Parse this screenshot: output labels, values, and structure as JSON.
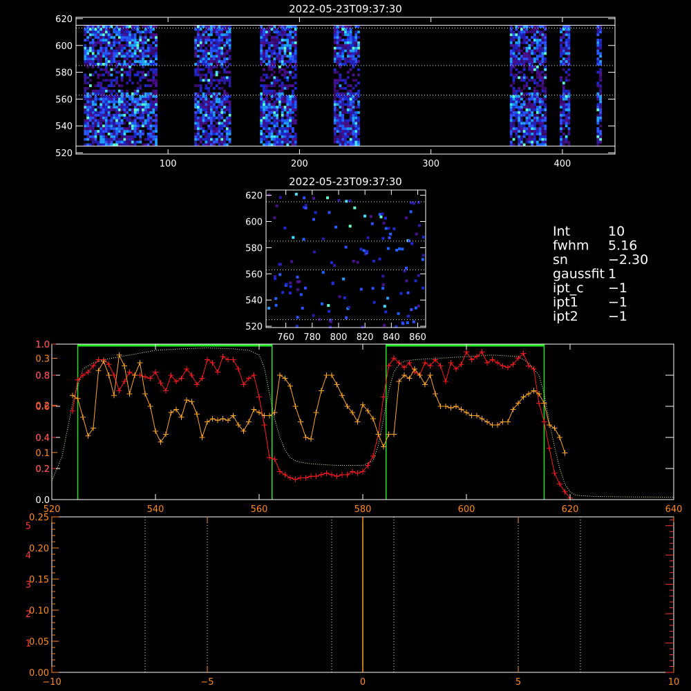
{
  "colors": {
    "background": "#000000",
    "axis": "#ffffff",
    "orange": "#ffa726",
    "red": "#ff1a1a",
    "green": "#22e622",
    "dotted_green": "#e8ffb0",
    "vertical_dotted": "#fff59d",
    "accent_orange_axis": "#ff8a1a",
    "accent_red_axis": "#ff3a3a"
  },
  "info_panel": {
    "lines": [
      {
        "key": "Int",
        "value": "10"
      },
      {
        "key": "fwhm",
        "value": "5.16"
      },
      {
        "key": "sn",
        "value": "−2.30"
      },
      {
        "key": "gaussfit",
        "value": "1"
      },
      {
        "key": "ipt_c",
        "value": "−1"
      },
      {
        "key": "ipt1",
        "value": "−1"
      },
      {
        "key": "ipt2",
        "value": "−1"
      }
    ]
  },
  "chart_data": [
    {
      "type": "heatmap",
      "title": "2022-05-23T09:37:30",
      "xlim": [
        30,
        440
      ],
      "ylim": [
        519,
        621
      ],
      "xticks": [
        100,
        200,
        300,
        400
      ],
      "yticks": [
        520,
        540,
        560,
        580,
        600,
        620
      ],
      "bright_column_bands": [
        [
          35,
          90
        ],
        [
          120,
          147
        ],
        [
          170,
          196
        ],
        [
          225,
          245
        ],
        [
          360,
          386
        ],
        [
          397,
          405
        ],
        [
          426,
          429
        ]
      ],
      "horizontal_lines": [
        {
          "y": 525,
          "style": "solid"
        },
        {
          "y": 615,
          "style": "solid"
        },
        {
          "y": 563,
          "style": "dotted"
        },
        {
          "y": 585,
          "style": "dotted"
        },
        {
          "y": 613,
          "style": "dotted"
        }
      ]
    },
    {
      "type": "heatmap",
      "title": "2022-05-23T09:37:30",
      "xlim": [
        745,
        866
      ],
      "ylim": [
        519,
        624
      ],
      "xticks": [
        760,
        780,
        800,
        820,
        840,
        860
      ],
      "yticks": [
        520,
        540,
        560,
        580,
        600,
        620
      ],
      "horizontal_lines": [
        {
          "y": 525,
          "style": "dotted"
        },
        {
          "y": 563,
          "style": "dotted"
        },
        {
          "y": 585,
          "style": "dotted"
        },
        {
          "y": 615,
          "style": "dotted"
        }
      ]
    },
    {
      "type": "line",
      "xlim": [
        520,
        640
      ],
      "xticks": [
        520,
        540,
        560,
        580,
        600,
        620,
        640
      ],
      "ylim": [
        0,
        1.0
      ],
      "left_axis_white_ticks": [
        "0.0",
        "0.2",
        "0.4",
        "0.6",
        "0.8",
        "1.0"
      ],
      "left_axis_white_tick_values": [
        0,
        0.2,
        0.4,
        0.6,
        0.8,
        1.0
      ],
      "left_axis_orange_ticks": [
        "0.1",
        "0.2",
        "0.3"
      ],
      "left_axis_orange_tick_values": [
        0.1,
        0.2,
        0.3
      ],
      "left_axis_orange_range": [
        0,
        0.33
      ],
      "left_axis_red_ticks": [
        "0.2",
        "0.4",
        "0.6",
        "0.8",
        "1.0"
      ],
      "left_axis_red_tick_values": [
        0.2,
        0.4,
        0.6,
        0.8,
        1.0
      ],
      "left_axis_red_range": [
        0,
        1.0
      ],
      "green_windows": [
        [
          525,
          562.5
        ],
        [
          584.5,
          615
        ]
      ],
      "series": [
        {
          "color": "#e8ffb0",
          "style": "dotted",
          "x": [
            520,
            522,
            524,
            526,
            528,
            530,
            535,
            540,
            545,
            550,
            555,
            558,
            560,
            561,
            562,
            563,
            564,
            565,
            566,
            567,
            568,
            570,
            575,
            580,
            582,
            583,
            584,
            585,
            586,
            587,
            588,
            590,
            595,
            600,
            605,
            610,
            612,
            614,
            615,
            616,
            617,
            618,
            619,
            620,
            621,
            622,
            625,
            630,
            635,
            640
          ],
          "y": [
            0.12,
            0.28,
            0.62,
            0.84,
            0.88,
            0.9,
            0.93,
            0.96,
            0.97,
            0.975,
            0.97,
            0.96,
            0.93,
            0.85,
            0.68,
            0.52,
            0.4,
            0.32,
            0.27,
            0.25,
            0.24,
            0.23,
            0.22,
            0.22,
            0.25,
            0.35,
            0.52,
            0.7,
            0.82,
            0.87,
            0.89,
            0.9,
            0.91,
            0.92,
            0.93,
            0.92,
            0.88,
            0.8,
            0.68,
            0.5,
            0.34,
            0.2,
            0.1,
            0.05,
            0.03,
            0.025,
            0.02,
            0.018,
            0.016,
            0.015
          ]
        },
        {
          "color": "#ff1a1a",
          "style": "solid-plus",
          "x": [
            524,
            525,
            526,
            527,
            528,
            529,
            530,
            531,
            532,
            533,
            534,
            535,
            536,
            537,
            538,
            539,
            540,
            541,
            542,
            543,
            544,
            545,
            546,
            547,
            548,
            549,
            550,
            551,
            552,
            553,
            554,
            555,
            556,
            557,
            558,
            559,
            560,
            561,
            562,
            563,
            564,
            565,
            566,
            567,
            568,
            569,
            570,
            571,
            572,
            573,
            574,
            575,
            576,
            577,
            578,
            579,
            580,
            581,
            582,
            583,
            584,
            585,
            586,
            587,
            588,
            589,
            590,
            591,
            592,
            593,
            594,
            595,
            596,
            597,
            598,
            599,
            600,
            601,
            602,
            603,
            604,
            605,
            606,
            607,
            608,
            609,
            610,
            611,
            612,
            613,
            614,
            615,
            616,
            617,
            618,
            619,
            620
          ],
          "y": [
            0.57,
            0.77,
            0.8,
            0.82,
            0.86,
            0.9,
            0.9,
            0.87,
            0.8,
            0.7,
            0.76,
            0.82,
            0.8,
            0.8,
            0.79,
            0.78,
            0.82,
            0.75,
            0.7,
            0.8,
            0.76,
            0.78,
            0.84,
            0.8,
            0.74,
            0.78,
            0.9,
            0.88,
            0.82,
            0.92,
            0.9,
            0.9,
            0.84,
            0.74,
            0.78,
            0.8,
            0.66,
            0.48,
            0.27,
            0.26,
            0.18,
            0.16,
            0.14,
            0.13,
            0.14,
            0.14,
            0.15,
            0.15,
            0.16,
            0.17,
            0.16,
            0.15,
            0.16,
            0.16,
            0.18,
            0.17,
            0.18,
            0.22,
            0.28,
            0.42,
            0.66,
            0.86,
            0.91,
            0.88,
            0.85,
            0.88,
            0.82,
            0.8,
            0.88,
            0.86,
            0.9,
            0.86,
            0.76,
            0.88,
            0.84,
            0.87,
            0.95,
            0.9,
            0.92,
            0.95,
            0.88,
            0.9,
            0.88,
            0.86,
            0.85,
            0.87,
            0.91,
            0.94,
            0.86,
            0.84,
            0.62,
            0.5,
            0.33,
            0.17,
            0.1,
            0.05,
            0.01
          ]
        },
        {
          "color": "#ffa726",
          "style": "solid-plus",
          "x": [
            524,
            525,
            526,
            527,
            528,
            529,
            530,
            531,
            532,
            533,
            534,
            535,
            536,
            537,
            538,
            539,
            540,
            541,
            542,
            543,
            544,
            545,
            546,
            547,
            548,
            549,
            550,
            551,
            552,
            553,
            554,
            555,
            556,
            557,
            558,
            559,
            560,
            561,
            562,
            563,
            564,
            565,
            566,
            567,
            568,
            569,
            570,
            571,
            572,
            573,
            574,
            575,
            576,
            577,
            578,
            579,
            580,
            581,
            582,
            583,
            584,
            585,
            586,
            587,
            588,
            589,
            590,
            591,
            592,
            593,
            594,
            595,
            596,
            597,
            598,
            599,
            600,
            601,
            602,
            603,
            604,
            605,
            606,
            607,
            608,
            609,
            610,
            611,
            612,
            613,
            614,
            615,
            616,
            617,
            618,
            619
          ],
          "y": [
            0.67,
            0.65,
            0.53,
            0.41,
            0.46,
            0.83,
            0.89,
            0.8,
            0.67,
            0.93,
            0.86,
            0.68,
            0.8,
            0.88,
            0.68,
            0.6,
            0.44,
            0.37,
            0.42,
            0.56,
            0.58,
            0.53,
            0.64,
            0.63,
            0.55,
            0.4,
            0.5,
            0.52,
            0.51,
            0.52,
            0.51,
            0.54,
            0.48,
            0.44,
            0.5,
            0.58,
            0.56,
            0.54,
            0.54,
            0.56,
            0.8,
            0.78,
            0.73,
            0.6,
            0.5,
            0.4,
            0.39,
            0.56,
            0.7,
            0.8,
            0.8,
            0.74,
            0.67,
            0.6,
            0.56,
            0.5,
            0.61,
            0.57,
            0.52,
            0.42,
            0.34,
            0.42,
            0.42,
            0.76,
            0.8,
            0.78,
            0.84,
            0.8,
            0.74,
            0.8,
            0.68,
            0.6,
            0.6,
            0.59,
            0.6,
            0.58,
            0.56,
            0.54,
            0.54,
            0.52,
            0.5,
            0.48,
            0.48,
            0.5,
            0.5,
            0.58,
            0.62,
            0.66,
            0.68,
            0.7,
            0.68,
            0.62,
            0.48,
            0.46,
            0.4,
            0.3
          ]
        }
      ]
    },
    {
      "type": "line",
      "xlim": [
        -10,
        10
      ],
      "xticks": [
        "−10",
        "−5",
        "0",
        "5",
        "10"
      ],
      "xtick_values": [
        -10,
        -5,
        0,
        5,
        10
      ],
      "ylim": [
        0,
        0.25
      ],
      "left_axis_orange_ticks": [
        "0.00",
        "0.05",
        "0.10",
        "0.15",
        "0.20",
        "0.25"
      ],
      "left_axis_orange_tick_values": [
        0,
        0.05,
        0.1,
        0.15,
        0.2,
        0.25
      ],
      "left_axis_red_ticks": [
        "1",
        "2",
        "3",
        "4",
        "5"
      ],
      "left_axis_red_tick_values": [
        1,
        2,
        3,
        4,
        5
      ],
      "left_axis_red_range": [
        0,
        5.3
      ],
      "vertical_dotted_lines": [
        -7,
        -5,
        -1,
        1,
        5,
        7
      ],
      "vertical_solid_line": 0
    }
  ]
}
